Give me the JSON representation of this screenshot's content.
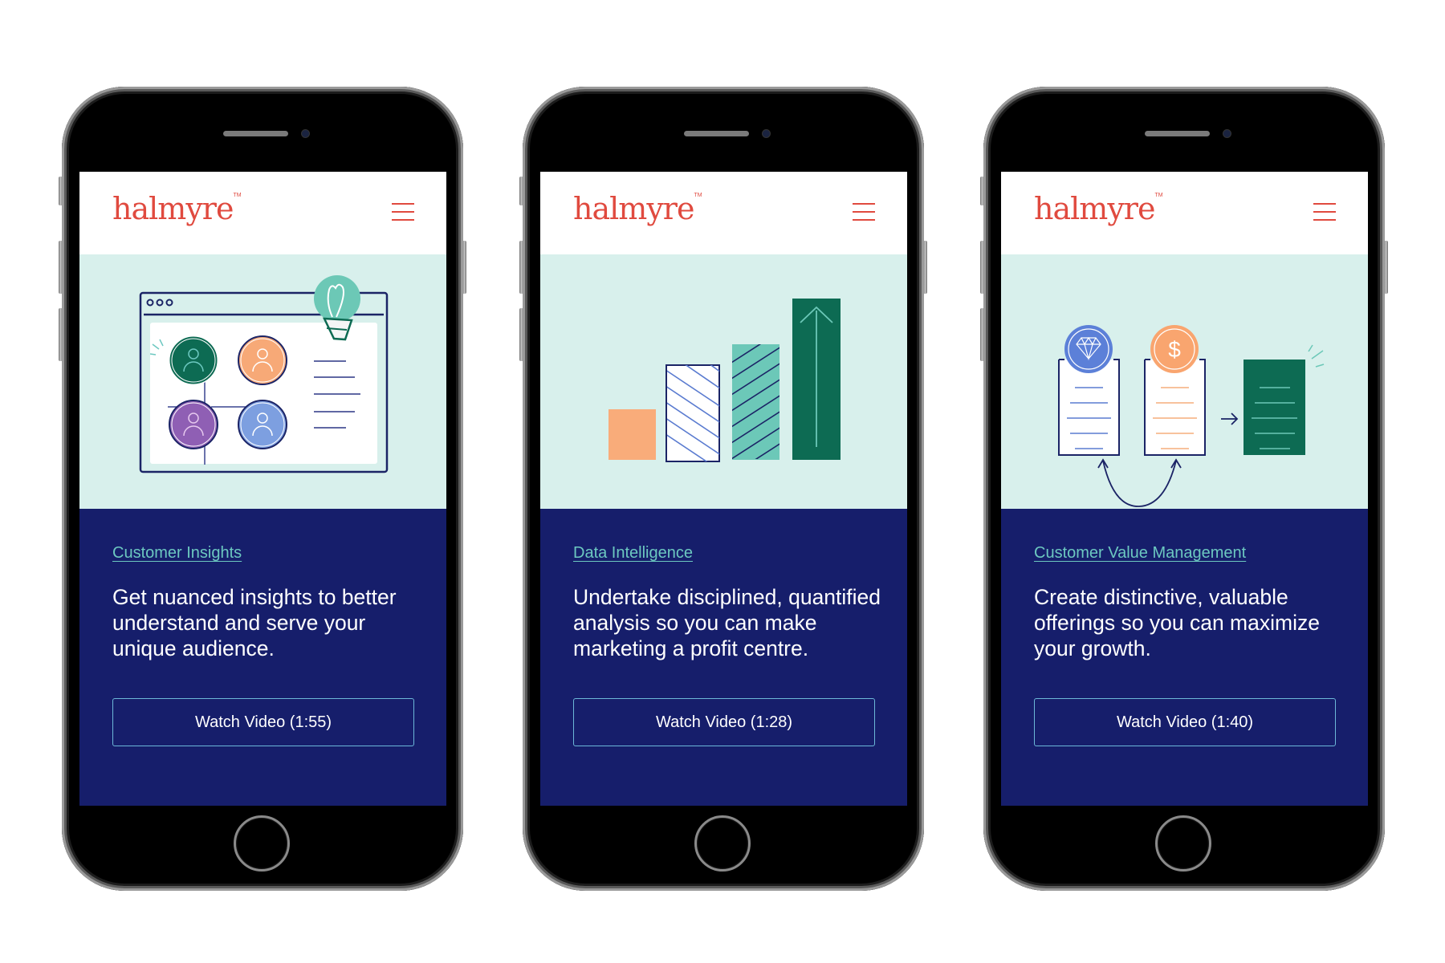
{
  "brand": {
    "name": "halmyre",
    "trademark": "TM",
    "color": "#e04a3f"
  },
  "colors": {
    "navy": "#161e6b",
    "mint": "#d8f0ec",
    "link": "#6cc8c0",
    "button_border": "#6cb8d8"
  },
  "phones": [
    {
      "illustration": "customer-insights-illustration",
      "category": "Customer Insights",
      "description": "Get nuanced insights to better understand and serve your unique audience.",
      "button": "Watch Video (1:55)"
    },
    {
      "illustration": "data-intelligence-illustration",
      "category": "Data Intelligence",
      "description": "Undertake disciplined, quantified analysis so you can make marketing a profit centre.",
      "button": "Watch Video (1:28)"
    },
    {
      "illustration": "customer-value-illustration",
      "category": "Customer Value Management",
      "description": "Create distinctive, valuable offerings so you can maximize your growth.",
      "button": "Watch Video (1:40)"
    }
  ],
  "icons": {
    "menu": "hamburger-menu-icon",
    "bulb": "lightbulb-icon",
    "user": "user-icon",
    "arrow": "arrow-up-icon",
    "diamond": "diamond-icon",
    "dollar": "dollar-icon"
  }
}
